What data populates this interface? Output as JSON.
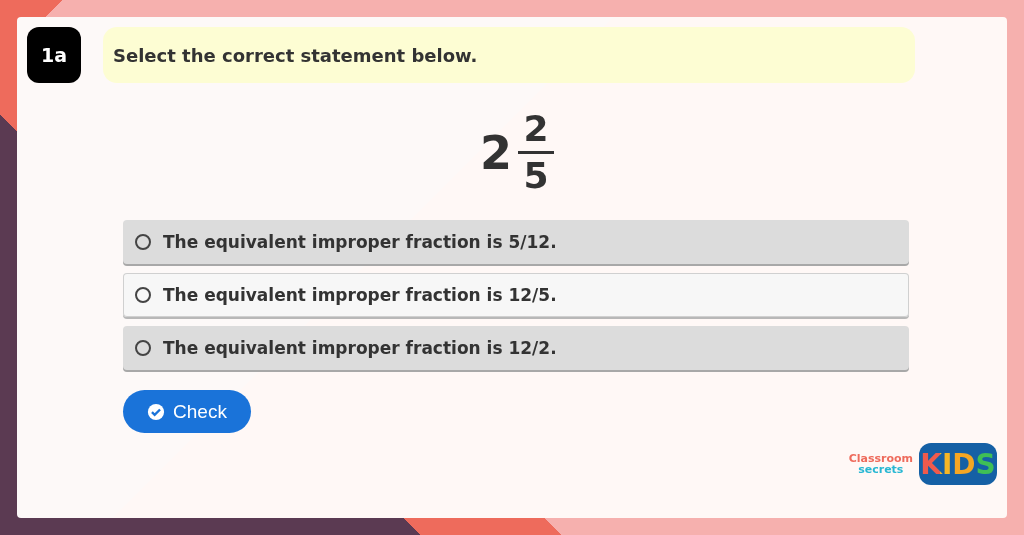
{
  "question": {
    "number": "1a",
    "prompt": "Select the correct statement below."
  },
  "fraction": {
    "whole": "2",
    "numerator": "2",
    "denominator": "5"
  },
  "options": [
    {
      "label": "The equivalent improper fraction is 5/12.",
      "selected": false,
      "hovered": false
    },
    {
      "label": "The equivalent improper fraction is 12/5.",
      "selected": false,
      "hovered": true
    },
    {
      "label": "The equivalent improper fraction is 12/2.",
      "selected": false,
      "hovered": false
    }
  ],
  "check_button": {
    "label": "Check"
  },
  "logo": {
    "line_1": "Classroom",
    "line_2": "secrets",
    "badge": "KIDS"
  }
}
